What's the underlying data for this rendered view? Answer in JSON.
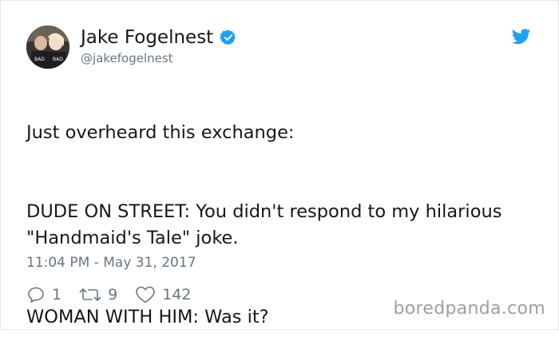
{
  "author": {
    "name": "Jake Fogelnest",
    "handle": "@jakefogelnest",
    "verified": true,
    "verified_color": "#1da1f2"
  },
  "icons": {
    "platform": "twitter-bird-icon",
    "reply": "reply-icon",
    "retweet": "retweet-icon",
    "like": "heart-icon"
  },
  "tweet": {
    "line1": "Just overheard this exchange:",
    "line2": "DUDE ON STREET: You didn't respond to my hilarious\n\"Handmaid's Tale\" joke.",
    "line3": "WOMAN WITH HIM: Was it?",
    "timestamp": "11:04 PM - May 31, 2017"
  },
  "stats": {
    "replies": "1",
    "retweets": "9",
    "likes": "142"
  },
  "watermark": "boredpanda.com",
  "colors": {
    "brand": "#1da1f2",
    "secondary_text": "#657786",
    "primary_text": "#14171a"
  }
}
